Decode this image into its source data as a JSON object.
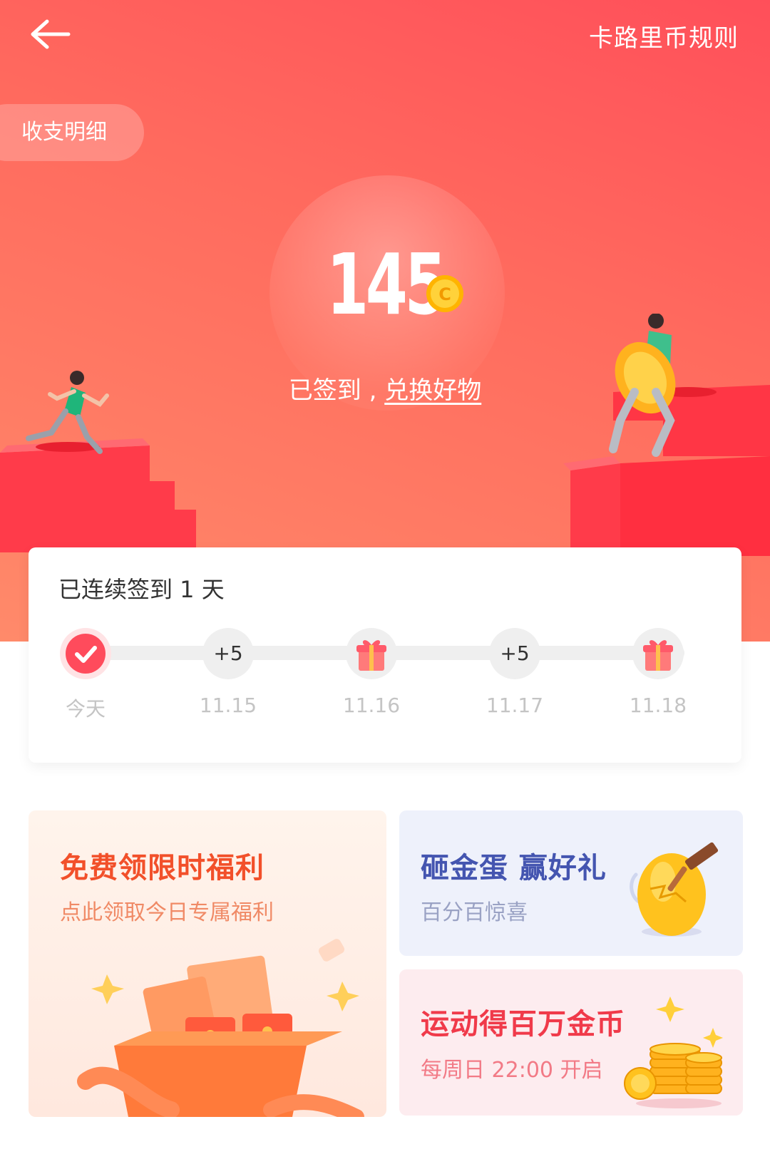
{
  "header": {
    "back_icon": "arrow-left-icon",
    "rules_label": "卡路里币规则",
    "ledger_label": "收支明细"
  },
  "balance": {
    "value": "145",
    "coin_icon": "coin-icon",
    "status_text": "已签到 , ",
    "exchange_link": "兑换好物"
  },
  "checkin": {
    "title": "已连续签到 1 天",
    "days": [
      {
        "label": "今天",
        "reward": "",
        "state": "checked"
      },
      {
        "label": "11.15",
        "reward": "+5",
        "state": "points"
      },
      {
        "label": "11.16",
        "reward": "",
        "state": "gift"
      },
      {
        "label": "11.17",
        "reward": "+5",
        "state": "points"
      },
      {
        "label": "11.18",
        "reward": "",
        "state": "gift"
      }
    ]
  },
  "promos": {
    "free": {
      "title": "免费领限时福利",
      "subtitle": "点此领取今日专属福利"
    },
    "egg": {
      "title": "砸金蛋 赢好礼",
      "subtitle": "百分百惊喜"
    },
    "sport": {
      "title": "运动得百万金币",
      "subtitle": "每周日 22:00 开启"
    }
  },
  "colors": {
    "hero_gradient_start": "#ff4f5a",
    "hero_gradient_end": "#ff8a6a",
    "accent_red": "#ff4b5c",
    "free_title": "#f2502a",
    "egg_title": "#4455b0",
    "sport_title": "#f03a4a"
  }
}
